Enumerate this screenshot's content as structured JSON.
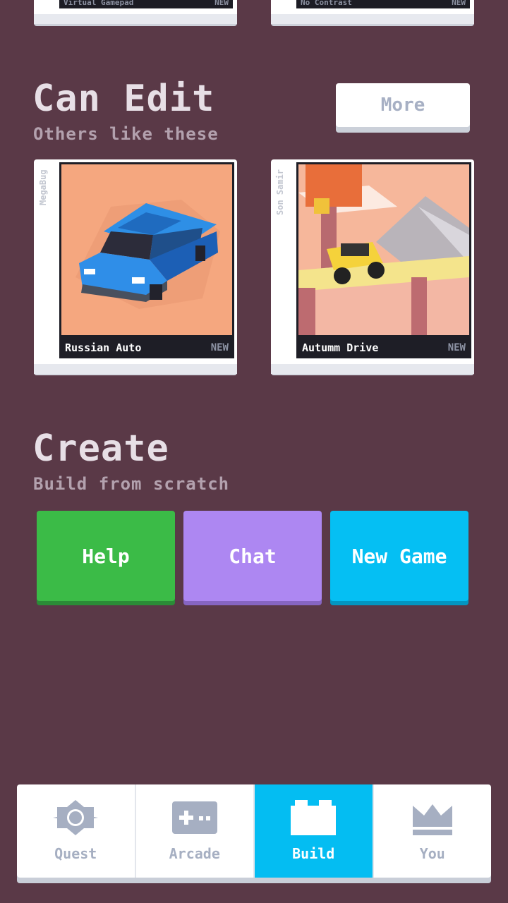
{
  "top_cards": [
    {
      "name": "Virtual Gamepad",
      "badge": "NEW"
    },
    {
      "name": "No Contrast",
      "badge": "NEW"
    }
  ],
  "can_edit": {
    "title": "Can Edit",
    "subtitle": "Others like these",
    "more_label": "More",
    "games": [
      {
        "author": "MegaBug",
        "title": "Russian Auto",
        "badge": "NEW"
      },
      {
        "author": "Son Samir",
        "title": "Autumm Drive",
        "badge": "NEW"
      }
    ]
  },
  "create": {
    "title": "Create",
    "subtitle": "Build from scratch",
    "buttons": {
      "help": "Help",
      "chat": "Chat",
      "new_game": "New Game"
    }
  },
  "tabs": [
    {
      "label": "Quest",
      "icon": "sun-gear-icon"
    },
    {
      "label": "Arcade",
      "icon": "gamepad-icon"
    },
    {
      "label": "Build",
      "icon": "brick-icon",
      "active": true
    },
    {
      "label": "You",
      "icon": "crown-icon"
    }
  ],
  "colors": {
    "background": "#5a3947",
    "help": "#3bbb47",
    "chat": "#ad87f2",
    "new_game": "#05bff3",
    "active_tab": "#04bdf2"
  }
}
